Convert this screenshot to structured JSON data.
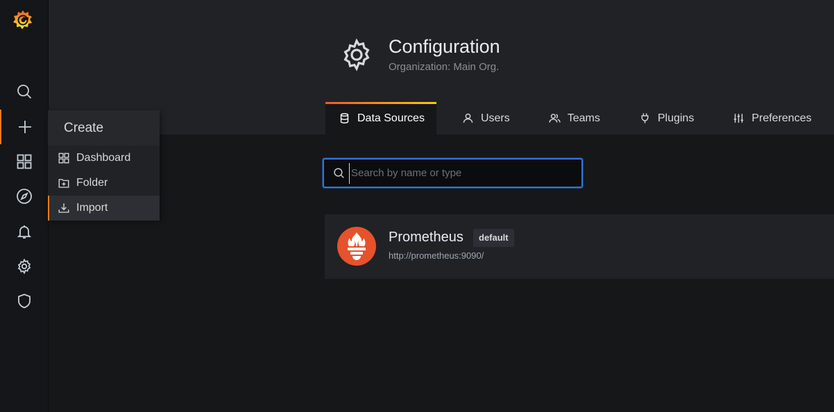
{
  "sidebar": {
    "items": [
      {
        "icon": "search-icon"
      },
      {
        "icon": "plus-icon"
      },
      {
        "icon": "apps-icon"
      },
      {
        "icon": "compass-icon"
      },
      {
        "icon": "bell-icon"
      },
      {
        "icon": "gear-icon"
      },
      {
        "icon": "shield-icon"
      }
    ]
  },
  "create_menu": {
    "title": "Create",
    "items": [
      {
        "label": "Dashboard",
        "icon": "apps-icon"
      },
      {
        "label": "Folder",
        "icon": "folder-plus-icon"
      },
      {
        "label": "Import",
        "icon": "import-icon"
      }
    ]
  },
  "header": {
    "title": "Configuration",
    "subtitle": "Organization: Main Org.",
    "tabs": [
      {
        "label": "Data Sources",
        "icon": "database-icon"
      },
      {
        "label": "Users",
        "icon": "user-icon"
      },
      {
        "label": "Teams",
        "icon": "users-icon"
      },
      {
        "label": "Plugins",
        "icon": "plug-icon"
      },
      {
        "label": "Preferences",
        "icon": "sliders-icon"
      }
    ]
  },
  "search": {
    "placeholder": "Search by name or type",
    "value": ""
  },
  "datasources": [
    {
      "name": "Prometheus",
      "badge": "default",
      "url": "http://prometheus:9090/"
    }
  ],
  "colors": {
    "accent": "#eb7b18",
    "focus": "#3274d9",
    "prometheus": "#e6522c"
  }
}
